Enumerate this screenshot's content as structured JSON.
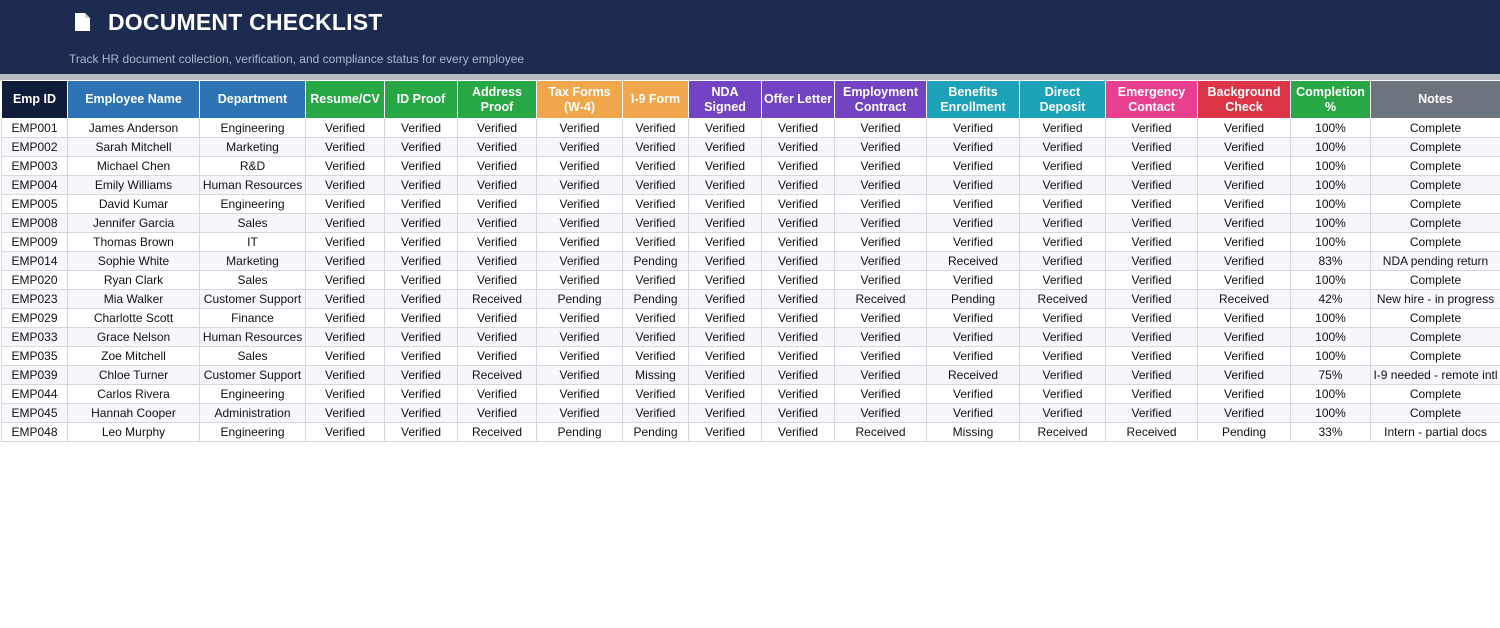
{
  "header": {
    "title": "DOCUMENT CHECKLIST",
    "subtitle": "Track HR document collection, verification, and compliance status for every employee",
    "icon": "document-icon"
  },
  "colors": {
    "banner": "#1c2b4f",
    "navy": "#0f1c3a",
    "blue": "#2e74b5",
    "green": "#28a745",
    "orange": "#f0a64a",
    "purple": "#7244c4",
    "teal": "#1ba2b8",
    "pink": "#e8408f",
    "red": "#dc3545",
    "gray": "#6c757d"
  },
  "columns": [
    {
      "label": "Emp ID",
      "color": "#0f1c3a"
    },
    {
      "label": "Employee Name",
      "color": "#2e74b5"
    },
    {
      "label": "Department",
      "color": "#2e74b5"
    },
    {
      "label": "Resume/CV",
      "color": "#28a745"
    },
    {
      "label": "ID Proof",
      "color": "#28a745"
    },
    {
      "label": "Address Proof",
      "color": "#28a745"
    },
    {
      "label": "Tax Forms (W-4)",
      "color": "#f0a64a"
    },
    {
      "label": "I-9 Form",
      "color": "#f0a64a"
    },
    {
      "label": "NDA Signed",
      "color": "#7244c4"
    },
    {
      "label": "Offer Letter",
      "color": "#7244c4"
    },
    {
      "label": "Employment Contract",
      "color": "#7244c4"
    },
    {
      "label": "Benefits Enrollment",
      "color": "#1ba2b8"
    },
    {
      "label": "Direct Deposit",
      "color": "#1ba2b8"
    },
    {
      "label": "Emergency Contact",
      "color": "#e8408f"
    },
    {
      "label": "Background Check",
      "color": "#dc3545"
    },
    {
      "label": "Completion %",
      "color": "#28a745"
    },
    {
      "label": "Notes",
      "color": "#6c757d"
    }
  ],
  "rows": [
    [
      "EMP001",
      "James Anderson",
      "Engineering",
      "Verified",
      "Verified",
      "Verified",
      "Verified",
      "Verified",
      "Verified",
      "Verified",
      "Verified",
      "Verified",
      "Verified",
      "Verified",
      "Verified",
      "100%",
      "Complete"
    ],
    [
      "EMP002",
      "Sarah Mitchell",
      "Marketing",
      "Verified",
      "Verified",
      "Verified",
      "Verified",
      "Verified",
      "Verified",
      "Verified",
      "Verified",
      "Verified",
      "Verified",
      "Verified",
      "Verified",
      "100%",
      "Complete"
    ],
    [
      "EMP003",
      "Michael Chen",
      "R&D",
      "Verified",
      "Verified",
      "Verified",
      "Verified",
      "Verified",
      "Verified",
      "Verified",
      "Verified",
      "Verified",
      "Verified",
      "Verified",
      "Verified",
      "100%",
      "Complete"
    ],
    [
      "EMP004",
      "Emily Williams",
      "Human Resources",
      "Verified",
      "Verified",
      "Verified",
      "Verified",
      "Verified",
      "Verified",
      "Verified",
      "Verified",
      "Verified",
      "Verified",
      "Verified",
      "Verified",
      "100%",
      "Complete"
    ],
    [
      "EMP005",
      "David Kumar",
      "Engineering",
      "Verified",
      "Verified",
      "Verified",
      "Verified",
      "Verified",
      "Verified",
      "Verified",
      "Verified",
      "Verified",
      "Verified",
      "Verified",
      "Verified",
      "100%",
      "Complete"
    ],
    [
      "EMP008",
      "Jennifer Garcia",
      "Sales",
      "Verified",
      "Verified",
      "Verified",
      "Verified",
      "Verified",
      "Verified",
      "Verified",
      "Verified",
      "Verified",
      "Verified",
      "Verified",
      "Verified",
      "100%",
      "Complete"
    ],
    [
      "EMP009",
      "Thomas Brown",
      "IT",
      "Verified",
      "Verified",
      "Verified",
      "Verified",
      "Verified",
      "Verified",
      "Verified",
      "Verified",
      "Verified",
      "Verified",
      "Verified",
      "Verified",
      "100%",
      "Complete"
    ],
    [
      "EMP014",
      "Sophie White",
      "Marketing",
      "Verified",
      "Verified",
      "Verified",
      "Verified",
      "Pending",
      "Verified",
      "Verified",
      "Verified",
      "Received",
      "Verified",
      "Verified",
      "Verified",
      "83%",
      "NDA pending return"
    ],
    [
      "EMP020",
      "Ryan Clark",
      "Sales",
      "Verified",
      "Verified",
      "Verified",
      "Verified",
      "Verified",
      "Verified",
      "Verified",
      "Verified",
      "Verified",
      "Verified",
      "Verified",
      "Verified",
      "100%",
      "Complete"
    ],
    [
      "EMP023",
      "Mia Walker",
      "Customer Support",
      "Verified",
      "Verified",
      "Received",
      "Pending",
      "Pending",
      "Verified",
      "Verified",
      "Received",
      "Pending",
      "Received",
      "Verified",
      "Received",
      "42%",
      "New hire - in progress"
    ],
    [
      "EMP029",
      "Charlotte Scott",
      "Finance",
      "Verified",
      "Verified",
      "Verified",
      "Verified",
      "Verified",
      "Verified",
      "Verified",
      "Verified",
      "Verified",
      "Verified",
      "Verified",
      "Verified",
      "100%",
      "Complete"
    ],
    [
      "EMP033",
      "Grace Nelson",
      "Human Resources",
      "Verified",
      "Verified",
      "Verified",
      "Verified",
      "Verified",
      "Verified",
      "Verified",
      "Verified",
      "Verified",
      "Verified",
      "Verified",
      "Verified",
      "100%",
      "Complete"
    ],
    [
      "EMP035",
      "Zoe Mitchell",
      "Sales",
      "Verified",
      "Verified",
      "Verified",
      "Verified",
      "Verified",
      "Verified",
      "Verified",
      "Verified",
      "Verified",
      "Verified",
      "Verified",
      "Verified",
      "100%",
      "Complete"
    ],
    [
      "EMP039",
      "Chloe Turner",
      "Customer Support",
      "Verified",
      "Verified",
      "Received",
      "Verified",
      "Missing",
      "Verified",
      "Verified",
      "Verified",
      "Received",
      "Verified",
      "Verified",
      "Verified",
      "75%",
      "I-9 needed - remote intl"
    ],
    [
      "EMP044",
      "Carlos Rivera",
      "Engineering",
      "Verified",
      "Verified",
      "Verified",
      "Verified",
      "Verified",
      "Verified",
      "Verified",
      "Verified",
      "Verified",
      "Verified",
      "Verified",
      "Verified",
      "100%",
      "Complete"
    ],
    [
      "EMP045",
      "Hannah Cooper",
      "Administration",
      "Verified",
      "Verified",
      "Verified",
      "Verified",
      "Verified",
      "Verified",
      "Verified",
      "Verified",
      "Verified",
      "Verified",
      "Verified",
      "Verified",
      "100%",
      "Complete"
    ],
    [
      "EMP048",
      "Leo Murphy",
      "Engineering",
      "Verified",
      "Verified",
      "Received",
      "Pending",
      "Pending",
      "Verified",
      "Verified",
      "Received",
      "Missing",
      "Received",
      "Received",
      "Pending",
      "33%",
      "Intern - partial docs"
    ]
  ]
}
